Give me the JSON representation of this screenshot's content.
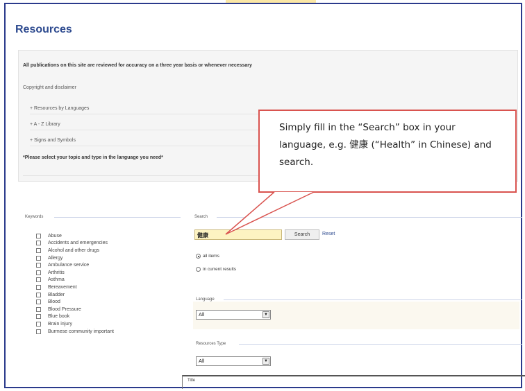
{
  "page": {
    "title": "Resources"
  },
  "info": {
    "review_notice": "All publications on this site are reviewed for accuracy on a three year basis or whenever necessary",
    "copyright": "Copyright and disclaimer",
    "links": [
      {
        "label": "+ Resources by Languages"
      },
      {
        "label": "+ A - Z Library"
      },
      {
        "label": "+ Signs and Symbols"
      }
    ],
    "note": "*Please select your topic and type in the language you need*"
  },
  "callout": {
    "text": "Simply fill in the “Search” box in your language, e.g. 健康 (“Health” in Chinese) and search."
  },
  "keywords": {
    "label": "Keywords",
    "items": [
      "Abuse",
      "Accidents and emergencies",
      "Alcohol and other drugs",
      "Allergy",
      "Ambulance service",
      "Arthritis",
      "Asthma",
      "Bereavement",
      "Bladder",
      "Blood",
      "Blood Pressure",
      "Blue book",
      "Brain injury",
      "Burmese community important"
    ]
  },
  "search": {
    "label": "Search",
    "value": "健康",
    "button": "Search",
    "reset": "Reset",
    "scope_options": [
      {
        "label": "all items",
        "selected": true
      },
      {
        "label": "in current results",
        "selected": false
      }
    ]
  },
  "language": {
    "label": "Language",
    "selected": "All"
  },
  "resources_type": {
    "label": "Resources Type",
    "selected": "All"
  },
  "results": {
    "column_title": "Title"
  },
  "colors": {
    "frame_border": "#2b3a8c",
    "title": "#2d4a8f",
    "callout_border": "#d9534f",
    "search_highlight": "#fdf3c2"
  }
}
